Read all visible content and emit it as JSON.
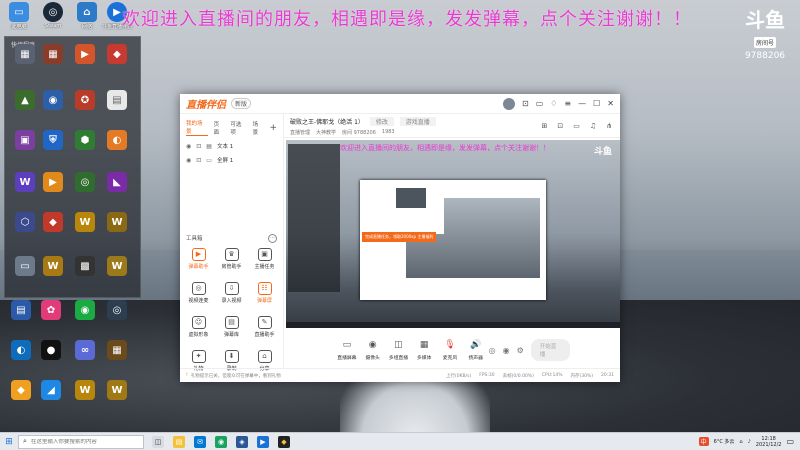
{
  "banner": {
    "text": "欢迎进入直播间的朋友，相遇即是缘，发发弹幕，点个关注谢谢！！"
  },
  "logo": {
    "mark": "斗鱼",
    "tag": "房间号",
    "room_number": "9788206"
  },
  "desktop": {
    "panel_header": "快捷程序",
    "icons_top": [
      "此电脑",
      "Steam",
      "网络",
      "斗鱼直播伴侣"
    ]
  },
  "app": {
    "brand": "直播伴侣",
    "badge": "新版",
    "tabs": [
      "我的场景",
      "页面",
      "可选项",
      "场景"
    ],
    "active_tab": 0,
    "scenes": [
      "文本 1",
      "全屏 1"
    ],
    "tools_header": "工具箱",
    "tools": [
      {
        "label": "弹幕助手",
        "icon": "▶",
        "active": true
      },
      {
        "label": "房管助手",
        "icon": "♛",
        "active": false
      },
      {
        "label": "主播任务",
        "icon": "▣",
        "active": false
      },
      {
        "label": "视频连麦",
        "icon": "◎",
        "active": false
      },
      {
        "label": "录入视频",
        "icon": "⇩",
        "active": false
      },
      {
        "label": "弹幕屏",
        "icon": "☷",
        "active": true
      },
      {
        "label": "虚拟形象",
        "icon": "☺",
        "active": false
      },
      {
        "label": "弹幕库",
        "icon": "▤",
        "active": false
      },
      {
        "label": "直播助手",
        "icon": "✎",
        "active": false
      },
      {
        "label": "礼物",
        "icon": "✦",
        "active": false
      },
      {
        "label": "录制",
        "icon": "⬇",
        "active": false
      },
      {
        "label": "分享",
        "icon": "⌂",
        "active": false
      }
    ],
    "room": {
      "title": "破败之王-佛耶戈（绝活 1）",
      "category_placeholder": "修改",
      "category_selected": "游戏直播",
      "meta": [
        "直播管理",
        "大神教学",
        "房间 9788206",
        "1983"
      ]
    },
    "preview": {
      "banner": "欢迎进入直播间的朋友，相遇即是缘，发发弹幕，点个关注谢谢！！",
      "logo": "斗鱼",
      "tip": "完成直播任务，领取2000xp 主播福利"
    },
    "controls": [
      {
        "label": "直播屏幕",
        "icon": "▭",
        "red": false
      },
      {
        "label": "摄像头",
        "icon": "◉",
        "red": false
      },
      {
        "label": "多组直播",
        "icon": "◫",
        "red": false
      },
      {
        "label": "多媒体",
        "icon": "▦",
        "red": false
      },
      {
        "label": "麦克风",
        "icon": "🎙",
        "red": true
      },
      {
        "label": "扬声器",
        "icon": "🔊",
        "red": false
      }
    ],
    "start_button": "开始直播",
    "status": {
      "warning": "!",
      "message": "礼物提示已关，但观众可在弹幕中，看到礼物",
      "stats": [
        "上行(0KB/s)",
        "FPS:30",
        "丢帧(0/0.00%)",
        "CPU:14%",
        "内存(30%)",
        "20:31"
      ]
    }
  },
  "taskbar": {
    "search_placeholder": "在这里输入你要搜索的内容",
    "tray": {
      "ime": "中",
      "weather": "6°C 多云",
      "time": "12:18",
      "date": "2021/12/2"
    }
  },
  "colors": {
    "accent": "#f36a1a",
    "banner": "#e83ad0",
    "start": "#1a72d9"
  }
}
